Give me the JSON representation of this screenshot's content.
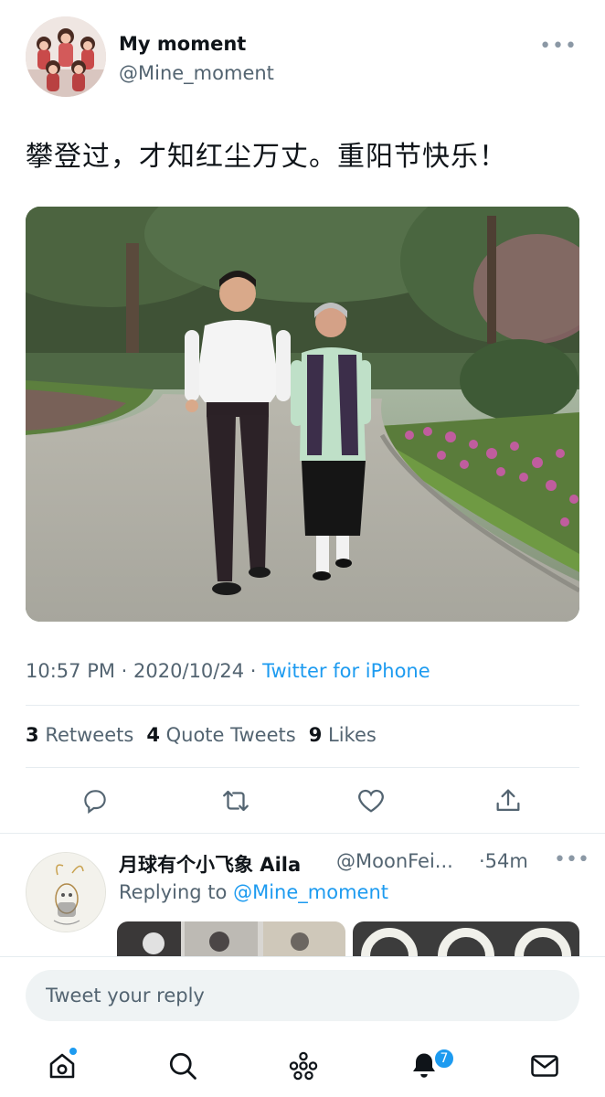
{
  "tweet": {
    "author_name": "My moment",
    "author_handle": "@Mine_moment",
    "text": "攀登过，才知红尘万丈。重阳节快乐！",
    "time": "10:57 PM",
    "separator": "·",
    "date": "2020/10/24",
    "source": "Twitter for iPhone",
    "stats": {
      "retweets_count": "3",
      "retweets_label": "Retweets",
      "quotes_count": "4",
      "quotes_label": "Quote Tweets",
      "likes_count": "9",
      "likes_label": "Likes"
    }
  },
  "reply": {
    "name": "月球有个小飞象 Aila",
    "handle": "@MoonFei...",
    "time": "·54m",
    "replying_prefix": "Replying to",
    "replying_mention": "@Mine_moment"
  },
  "composer": {
    "placeholder": "Tweet your reply"
  },
  "nav": {
    "notification_count": "7"
  },
  "icons": {
    "more": "more-horizontal-icon",
    "reply": "reply-icon",
    "retweet": "retweet-icon",
    "like": "heart-icon",
    "share": "share-icon",
    "home": "home-icon",
    "search": "search-icon",
    "spaces": "spaces-icon",
    "notifications": "bell-icon",
    "messages": "mail-icon"
  },
  "colors": {
    "accent": "#1d9bf0",
    "text_primary": "#0f1419",
    "text_secondary": "#536471",
    "divider": "#e6ecf0"
  }
}
